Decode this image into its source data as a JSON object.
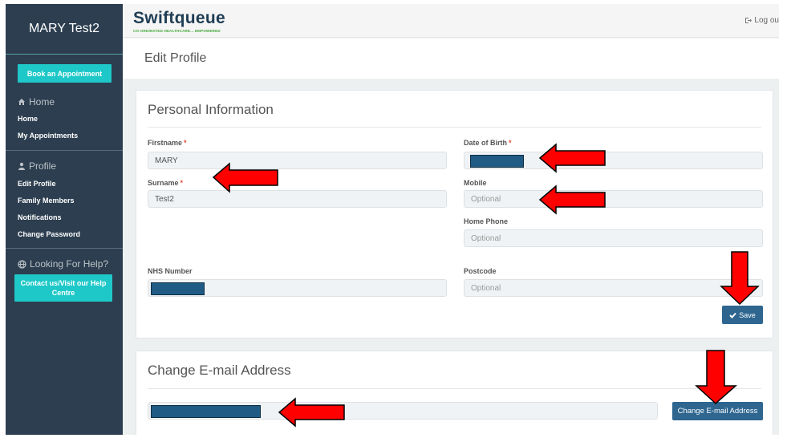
{
  "user": {
    "name": "MARY Test2"
  },
  "sidebar": {
    "book_button": "Book an Appointment",
    "home_section": {
      "icon": "home-icon",
      "title": "Home"
    },
    "home_items": [
      {
        "label": "Home"
      },
      {
        "label": "My Appointments"
      }
    ],
    "profile_section": {
      "icon": "user-icon",
      "title": "Profile"
    },
    "profile_items": [
      {
        "label": "Edit Profile"
      },
      {
        "label": "Family Members"
      },
      {
        "label": "Notifications"
      },
      {
        "label": "Change Password"
      }
    ],
    "help_section": {
      "icon": "globe-icon",
      "title": "Looking For Help?"
    },
    "help_button": "Contact us/Visit our Help Centre"
  },
  "header": {
    "logo": "Swiftqueue",
    "logo_tagline": "CO-ORDINATED HEALTHCARE... EMPOWERED",
    "logout": "Log ou"
  },
  "page": {
    "title": "Edit Profile"
  },
  "personal": {
    "title": "Personal Information",
    "firstname": {
      "label": "Firstname",
      "value": "MARY"
    },
    "surname": {
      "label": "Surname",
      "value": "Test2"
    },
    "dob": {
      "label": "Date of Birth",
      "value": ""
    },
    "mobile": {
      "label": "Mobile",
      "placeholder": "Optional"
    },
    "home_phone": {
      "label": "Home Phone",
      "placeholder": "Optional"
    },
    "nhs": {
      "label": "NHS Number",
      "value": ""
    },
    "postcode": {
      "label": "Postcode",
      "placeholder": "Optional"
    },
    "required_mark": "*",
    "save_button": "Save"
  },
  "email": {
    "title": "Change E-mail Address",
    "value": "",
    "change_button": "Change E-mail Address"
  },
  "colors": {
    "sidebar_bg": "#2c3e50",
    "accent_teal": "#1fc8c8",
    "button_blue": "#2e6690",
    "annotation_red": "#ff0000"
  }
}
